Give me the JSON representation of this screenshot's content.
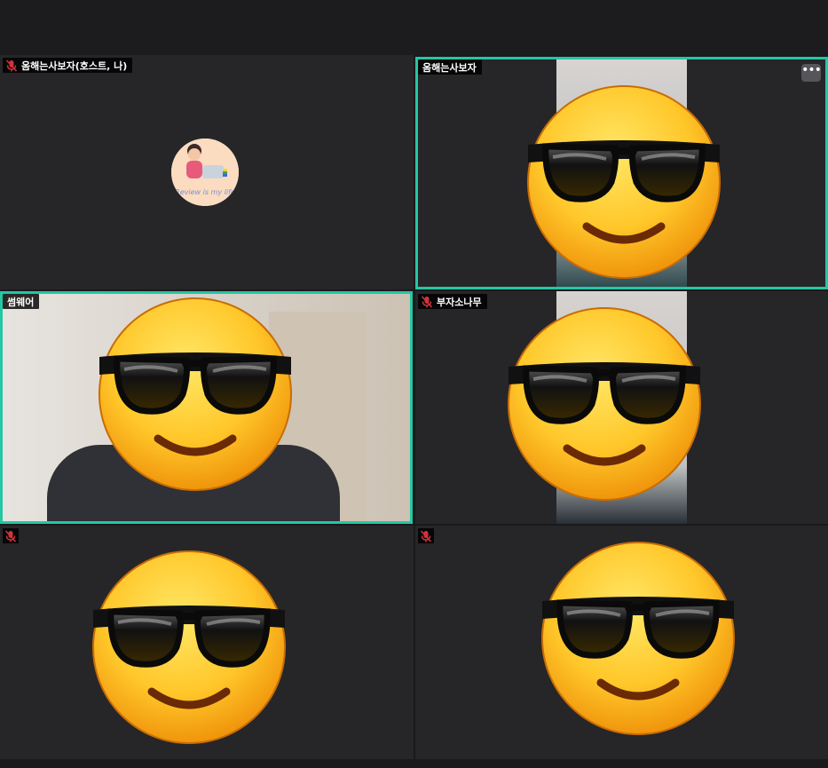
{
  "meeting": {
    "participants": [
      {
        "id": "p1",
        "name": "옴해는사보자(호스트, 나)",
        "muted": true,
        "video": false,
        "avatar_text": "Review is my life"
      },
      {
        "id": "p2",
        "name": "옴해는사보자",
        "muted": false,
        "video": true,
        "speaking": true
      },
      {
        "id": "p3",
        "name": "썸웨어",
        "muted": false,
        "video": true,
        "speaking": true
      },
      {
        "id": "p4",
        "name": "부자소나무",
        "muted": true,
        "video": true
      },
      {
        "id": "p5",
        "name": "",
        "muted": true,
        "video": true
      },
      {
        "id": "p6",
        "name": "",
        "muted": true,
        "video": true
      }
    ],
    "more_button_label": "•••"
  },
  "colors": {
    "active_border": "#23c7a3",
    "tile_bg": "#262629",
    "mute_icon": "#d0333b"
  },
  "icons": {
    "mute": "muted-microphone-icon",
    "more": "more-options-icon",
    "emoji": "sunglasses-emoji-icon"
  }
}
